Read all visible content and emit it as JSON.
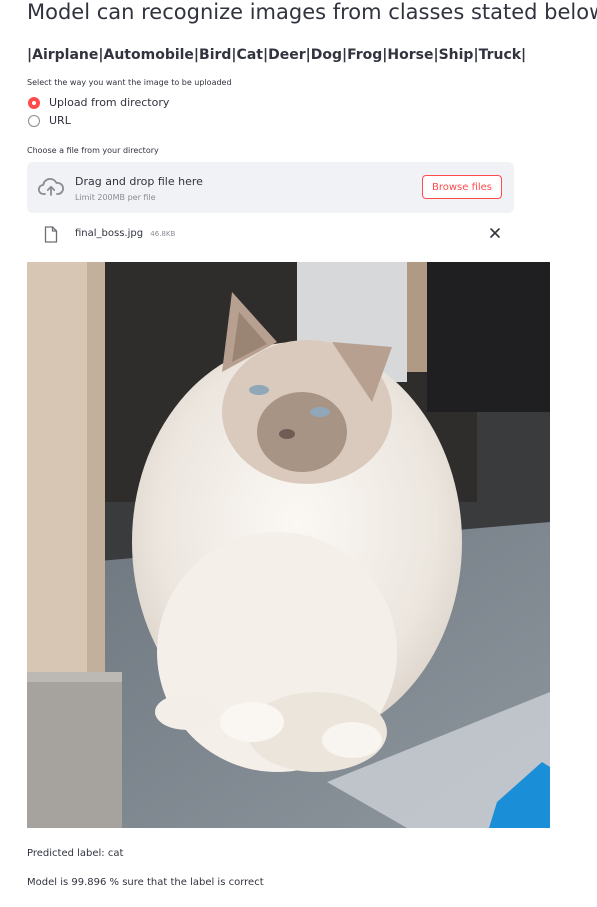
{
  "header": {
    "title": "Model can recognize images from classes stated below:",
    "classes_line": "|Airplane|Automobile|Bird|Cat|Deer|Dog|Frog|Horse|Ship|Truck|"
  },
  "upload_mode": {
    "label": "Select the way you want the image to be uploaded",
    "options": [
      {
        "label": "Upload from directory",
        "selected": true
      },
      {
        "label": "URL",
        "selected": false
      }
    ]
  },
  "uploader": {
    "label": "Choose a file from your directory",
    "drop_text": "Drag and drop file here",
    "limit_text": "Limit 200MB per file",
    "browse_label": "Browse files",
    "accent_color": "#ff4b4b",
    "file": {
      "name": "final_boss.jpg",
      "size": "46.8KB"
    }
  },
  "image": {
    "icon": "uploaded-cat-photo"
  },
  "result": {
    "predicted": "Predicted label: cat",
    "confidence": "Model is 99.896 % sure that the label is correct"
  }
}
